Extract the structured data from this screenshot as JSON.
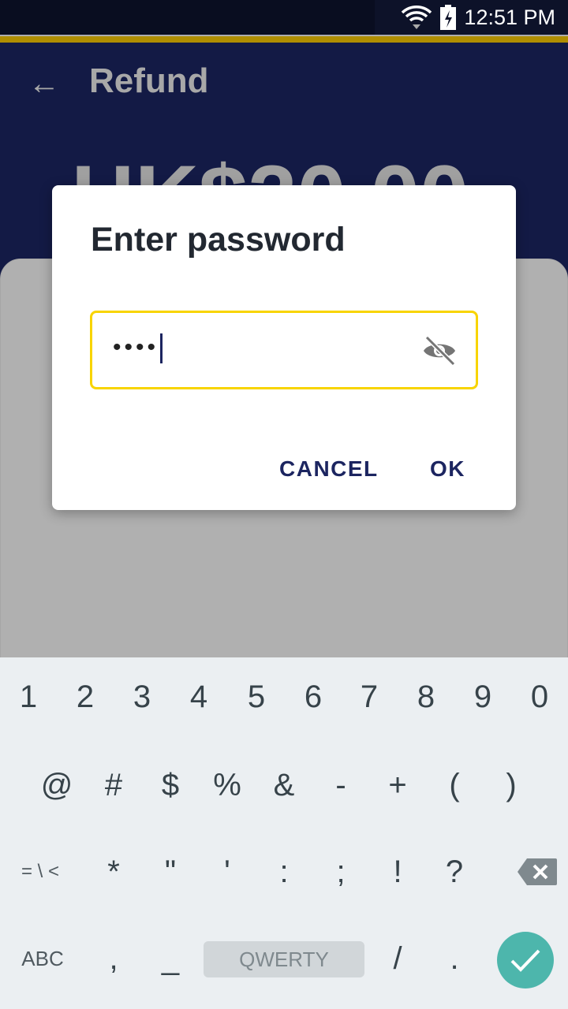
{
  "status_bar": {
    "time": "12:51 PM",
    "icons": [
      "wifi-icon",
      "battery-charging-icon"
    ]
  },
  "app_bar": {
    "title": "Refund",
    "back_icon": "arrow-left-icon"
  },
  "amount": "HK$20.00",
  "dialog": {
    "title": "Enter password",
    "password_value": "••••",
    "toggle_icon": "eye-off-icon",
    "cancel_label": "CANCEL",
    "ok_label": "OK"
  },
  "keyboard": {
    "row1": [
      "1",
      "2",
      "3",
      "4",
      "5",
      "6",
      "7",
      "8",
      "9",
      "0"
    ],
    "row2": [
      "@",
      "#",
      "$",
      "%",
      "&",
      "-",
      "+",
      "(",
      ")"
    ],
    "row3": [
      "= \\ <",
      "*",
      "\"",
      "'",
      ":",
      ";",
      "!",
      "?"
    ],
    "row4": {
      "abc": "ABC",
      "comma": ",",
      "underscore": "_",
      "space": "QWERTY",
      "slash": "/",
      "period": "."
    },
    "accent": "#4db6ac"
  },
  "colors": {
    "app_bar": "#131a45",
    "accent_line": "#b08e00",
    "field_border": "#f8d400",
    "button_text": "#1c2560"
  }
}
